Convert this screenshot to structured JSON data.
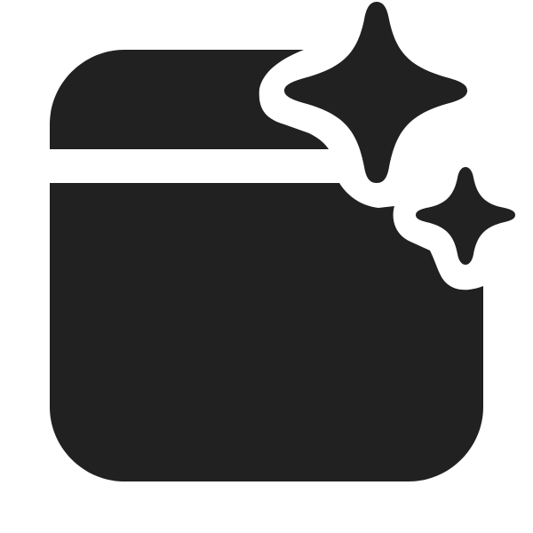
{
  "icon": {
    "name": "window-sparkle-icon",
    "color": "#212121",
    "background": "#ffffff"
  }
}
